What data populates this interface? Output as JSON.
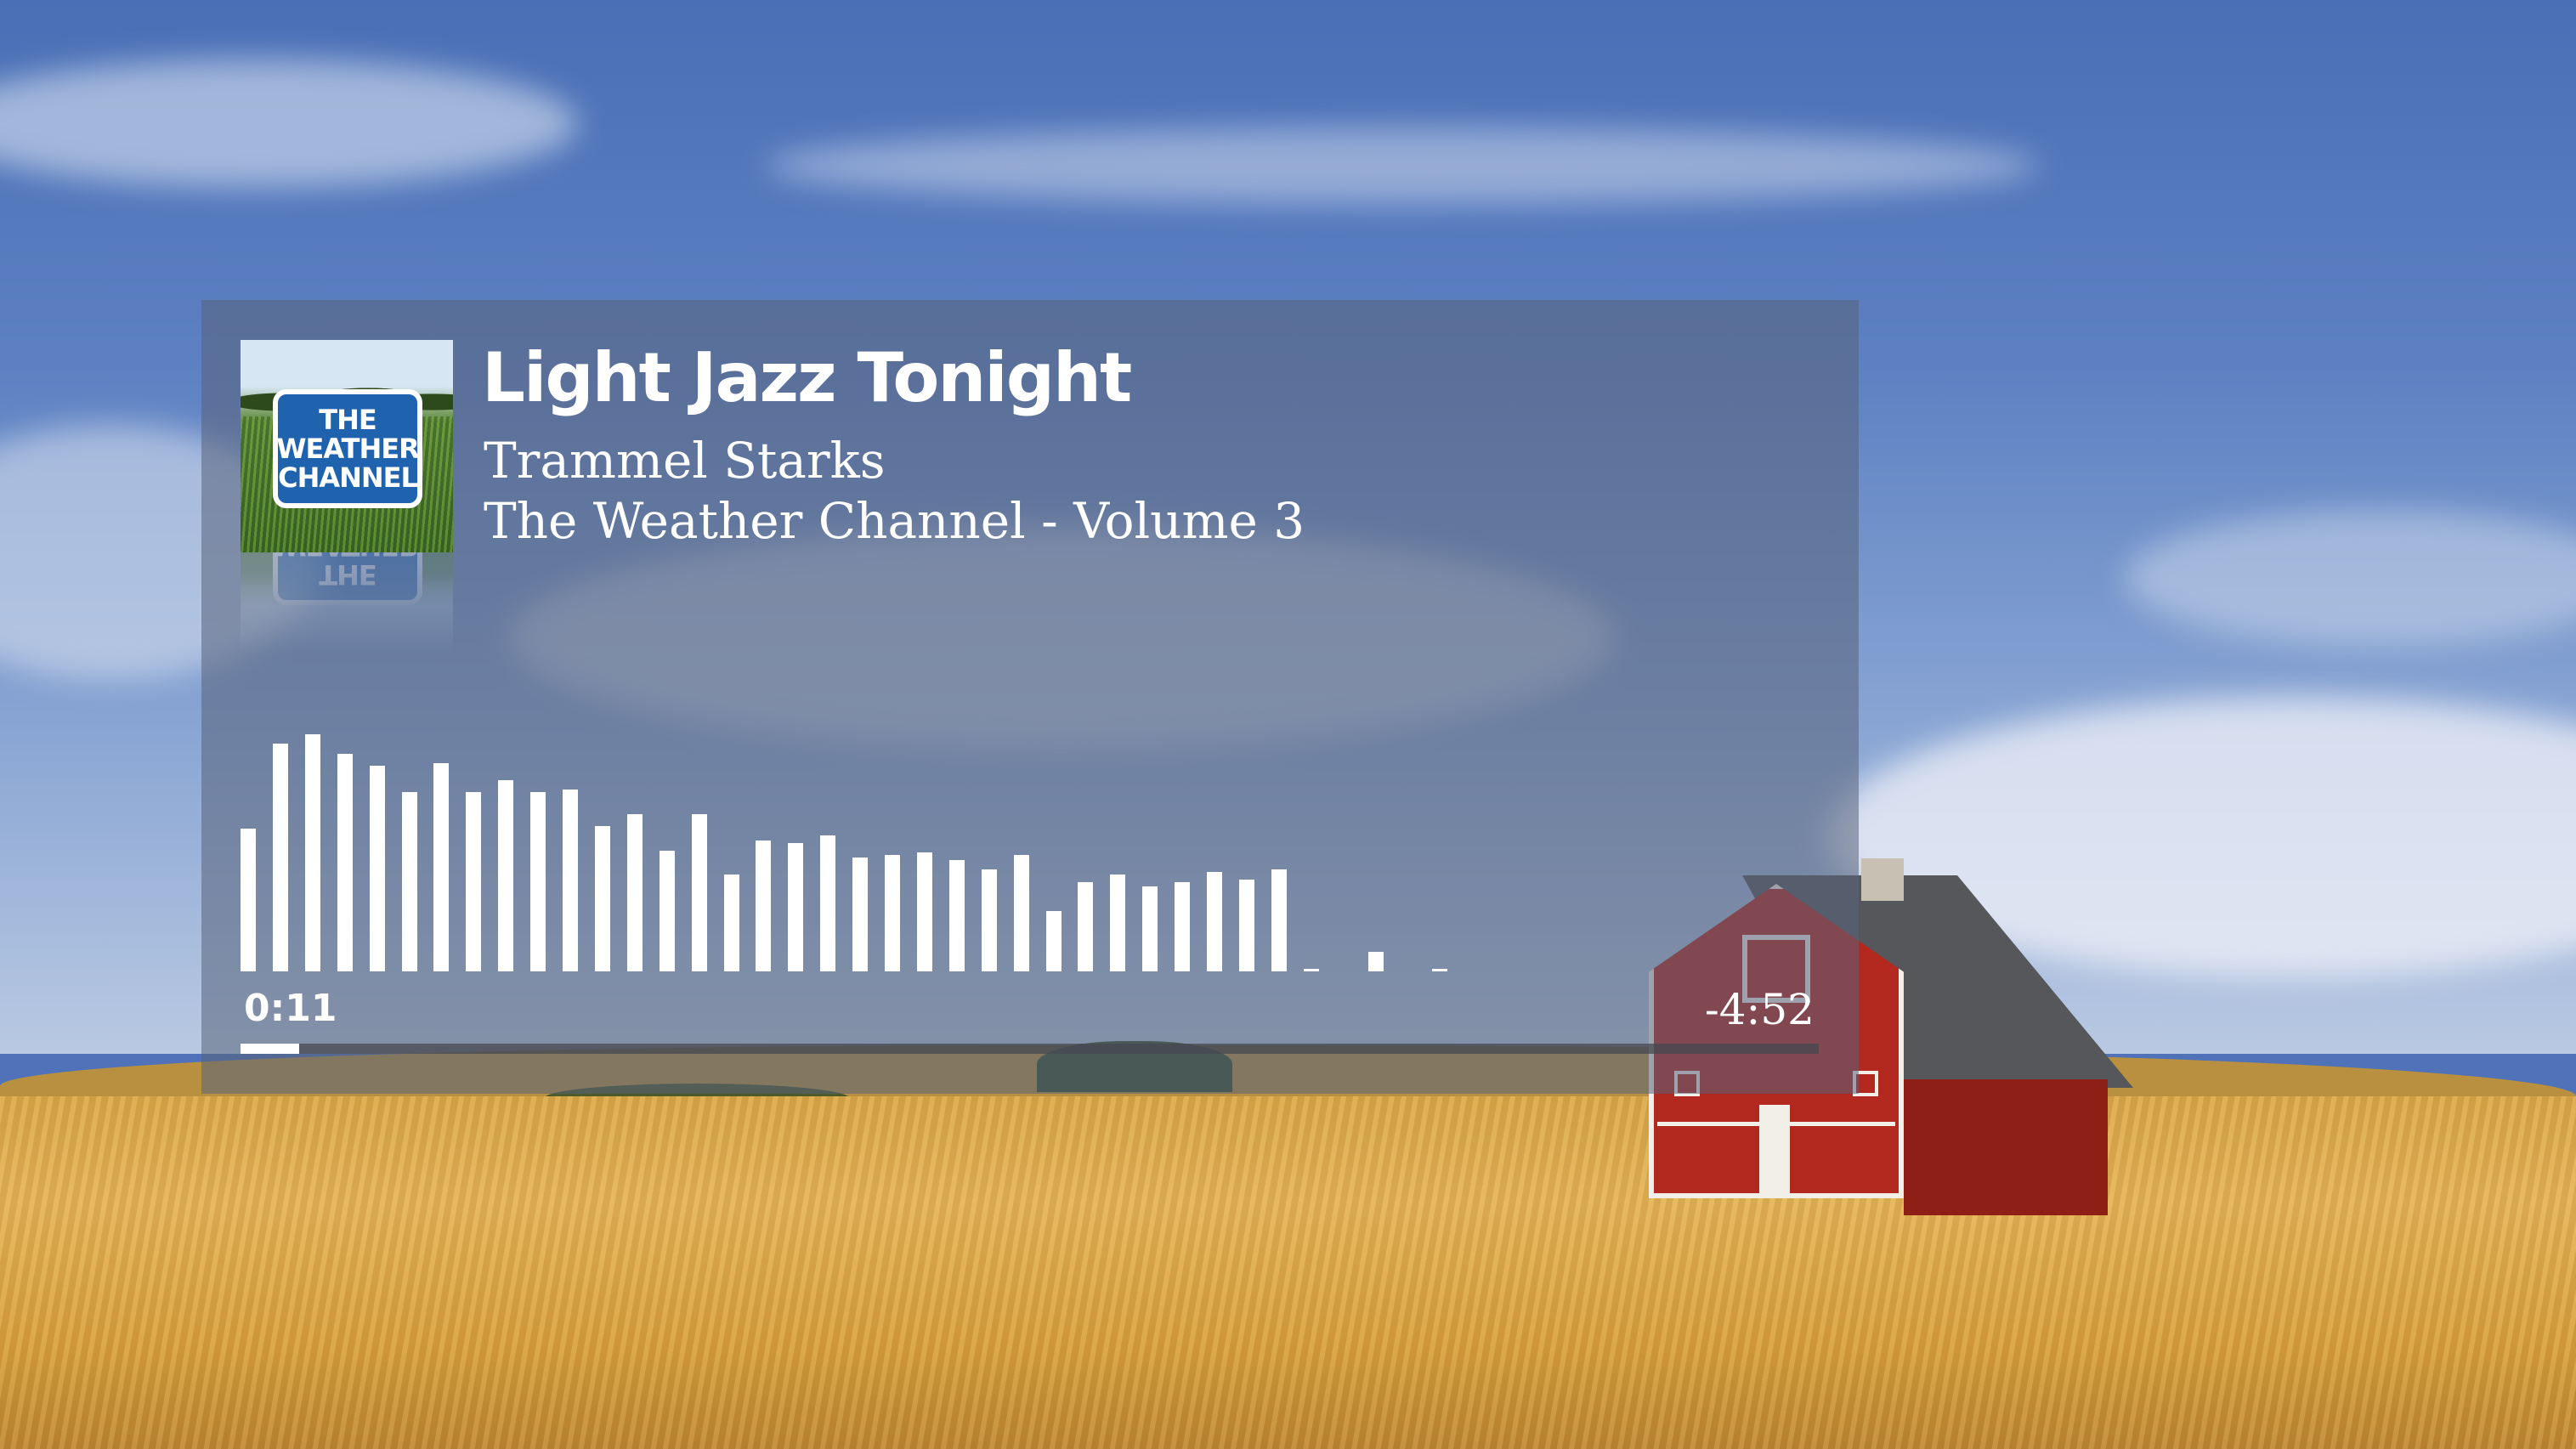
{
  "now_playing": {
    "title": "Light Jazz Tonight",
    "artist": "Trammel Starks",
    "album": "The Weather Channel - Volume 3",
    "album_art_logo_lines": [
      "THE",
      "WEATHER",
      "CHANNEL"
    ]
  },
  "playback": {
    "elapsed": "0:11",
    "remaining": "-4:52",
    "progress_fraction": 0.037
  },
  "visualizer": {
    "levels": [
      0.59,
      0.94,
      0.98,
      0.9,
      0.85,
      0.74,
      0.86,
      0.74,
      0.79,
      0.74,
      0.75,
      0.6,
      0.65,
      0.5,
      0.65,
      0.4,
      0.54,
      0.53,
      0.56,
      0.47,
      0.48,
      0.49,
      0.46,
      0.42,
      0.48,
      0.25,
      0.37,
      0.4,
      0.35,
      0.37,
      0.41,
      0.38,
      0.42,
      0.01,
      0.0,
      0.08,
      0.0,
      0.01
    ],
    "color": "#ffffff"
  },
  "colors": {
    "card_background": "rgba(88, 98, 122, 0.55)",
    "text": "#ffffff",
    "progress_fill": "#ffffff",
    "progress_track": "#46484f",
    "logo_blue": "#1f62ae"
  }
}
